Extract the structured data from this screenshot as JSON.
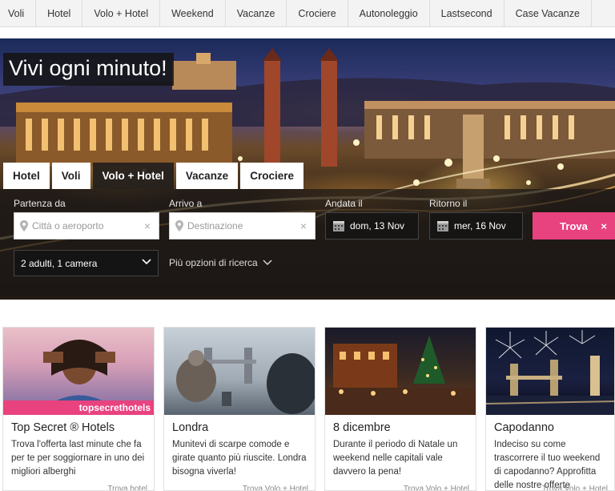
{
  "nav": {
    "items": [
      "Voli",
      "Hotel",
      "Volo + Hotel",
      "Weekend",
      "Vacanze",
      "Crociere",
      "Autonoleggio",
      "Lastsecond",
      "Case Vacanze"
    ]
  },
  "hero": {
    "title": "Vivi ogni minuto!",
    "tabs": [
      {
        "label": "Hotel",
        "active": false
      },
      {
        "label": "Voli",
        "active": false
      },
      {
        "label": "Volo + Hotel",
        "active": true
      },
      {
        "label": "Vacanze",
        "active": false
      },
      {
        "label": "Crociere",
        "active": false
      }
    ]
  },
  "search": {
    "from_label": "Partenza da",
    "from_placeholder": "Città o aeroporto",
    "to_label": "Arrivo a",
    "to_placeholder": "Destinazione",
    "depart_label": "Andata il",
    "depart_value": "dom, 13 Nov",
    "return_label": "Ritorno il",
    "return_value": "mer, 16 Nov",
    "submit_label": "Trova",
    "guests_value": "2 adulti, 1 camera",
    "more_options": "Più opzioni di ricerca",
    "clear_glyph": "×"
  },
  "cards": [
    {
      "title": "Top Secret ® Hotels",
      "desc": "Trova l'offerta last minute che fa per te per soggiornare in uno dei migliori alberghi",
      "badge": "topsecrethotels",
      "link": "Trova hotel"
    },
    {
      "title": "Londra",
      "desc": "Munitevi di scarpe comode e girate quanto più riuscite. Londra bisogna viverla!",
      "link": "Trova Volo + Hotel"
    },
    {
      "title": "8 dicembre",
      "desc": "Durante il periodo di Natale un weekend nelle capitali vale davvero la pena!",
      "link": "Trova Volo + Hotel"
    },
    {
      "title": "Capodanno",
      "desc": "Indeciso su come trascorrere il tuo weekend di capodanno? Approfitta delle nostre offerte",
      "link": "Trova Volo + Hotel"
    }
  ],
  "colors": {
    "accent": "#e8427f",
    "nav_bg": "#f3f3f3"
  }
}
